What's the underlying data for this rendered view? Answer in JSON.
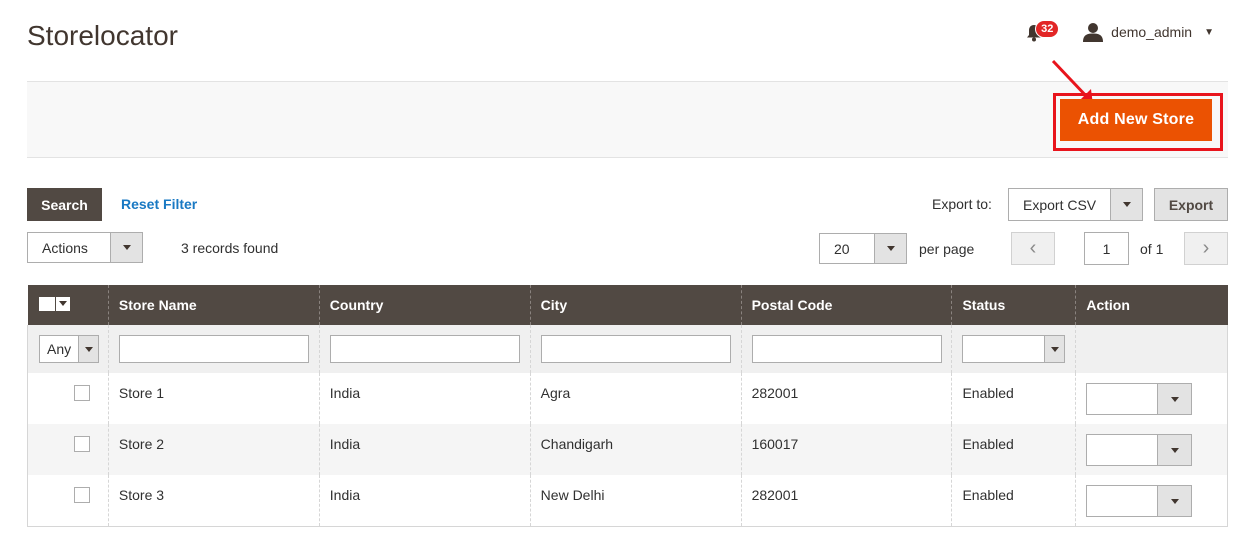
{
  "page": {
    "title": "Storelocator"
  },
  "header": {
    "notification_count": "32",
    "username": "demo_admin"
  },
  "toolbar": {
    "primary_button": "Add New Store"
  },
  "grid": {
    "search_label": "Search",
    "reset_label": "Reset Filter",
    "export_label": "Export to:",
    "export_format": "Export CSV",
    "export_button": "Export",
    "actions_label": "Actions",
    "records_found": "3 records found",
    "per_page_value": "20",
    "per_page_label": "per page",
    "current_page": "1",
    "page_of": "of 1",
    "columns": [
      "Store Name",
      "Country",
      "City",
      "Postal Code",
      "Status",
      "Action"
    ],
    "filter_any": "Any",
    "rows": [
      {
        "name": "Store 1",
        "country": "India",
        "city": "Agra",
        "postal": "282001",
        "status": "Enabled"
      },
      {
        "name": "Store 2",
        "country": "India",
        "city": "Chandigarh",
        "postal": "160017",
        "status": "Enabled"
      },
      {
        "name": "Store 3",
        "country": "India",
        "city": "New Delhi",
        "postal": "282001",
        "status": "Enabled"
      }
    ]
  },
  "colors": {
    "accent": "#eb5202",
    "header_bg": "#514943",
    "link": "#1979c3",
    "highlight": "#e8141c"
  }
}
